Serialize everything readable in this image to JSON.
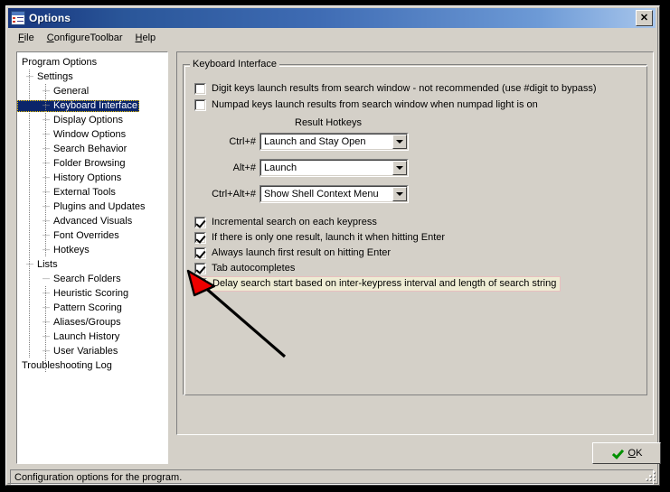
{
  "window": {
    "title": "Options",
    "icon": "options-checklist-icon",
    "close_label": "✕"
  },
  "menubar": {
    "items": [
      {
        "label": "File",
        "accel": "F"
      },
      {
        "label": "ConfigureToolbar",
        "accel": "C"
      },
      {
        "label": "Help",
        "accel": "H"
      }
    ]
  },
  "tree": {
    "items": [
      {
        "label": "Program Options",
        "level": 0,
        "selected": false
      },
      {
        "label": "Settings",
        "level": 1,
        "selected": false
      },
      {
        "label": "General",
        "level": 2,
        "selected": false
      },
      {
        "label": "Keyboard Interface",
        "level": 2,
        "selected": true
      },
      {
        "label": "Display Options",
        "level": 2,
        "selected": false
      },
      {
        "label": "Window Options",
        "level": 2,
        "selected": false
      },
      {
        "label": "Search Behavior",
        "level": 2,
        "selected": false
      },
      {
        "label": "Folder Browsing",
        "level": 2,
        "selected": false
      },
      {
        "label": "History Options",
        "level": 2,
        "selected": false
      },
      {
        "label": "External Tools",
        "level": 2,
        "selected": false
      },
      {
        "label": "Plugins and Updates",
        "level": 2,
        "selected": false
      },
      {
        "label": "Advanced Visuals",
        "level": 2,
        "selected": false
      },
      {
        "label": "Font Overrides",
        "level": 2,
        "selected": false
      },
      {
        "label": "Hotkeys",
        "level": 2,
        "selected": false
      },
      {
        "label": "Lists",
        "level": 1,
        "selected": false
      },
      {
        "label": "Search Folders",
        "level": 2,
        "selected": false
      },
      {
        "label": "Heuristic Scoring",
        "level": 2,
        "selected": false
      },
      {
        "label": "Pattern Scoring",
        "level": 2,
        "selected": false
      },
      {
        "label": "Aliases/Groups",
        "level": 2,
        "selected": false
      },
      {
        "label": "Launch History",
        "level": 2,
        "selected": false
      },
      {
        "label": "User Variables",
        "level": 2,
        "selected": false
      },
      {
        "label": "Troubleshooting Log",
        "level": 0,
        "selected": false
      }
    ]
  },
  "groupbox": {
    "title": "Keyboard Interface",
    "top_checkboxes": [
      {
        "label": "Digit keys launch results from search window  - not recommended (use #digit to bypass)",
        "checked": false
      },
      {
        "label": "Numpad keys launch results from search window when numpad light is on",
        "checked": false
      }
    ],
    "hotkeys_title": "Result Hotkeys",
    "hotkeys": [
      {
        "label": "Ctrl+#",
        "value": "Launch and Stay Open"
      },
      {
        "label": "Alt+#",
        "value": "Launch"
      },
      {
        "label": "Ctrl+Alt+#",
        "value": "Show Shell Context Menu"
      }
    ],
    "bottom_checkboxes": [
      {
        "label": "Incremental search on each keypress",
        "checked": true,
        "highlighted": false
      },
      {
        "label": "If there is only one result, launch it when hitting Enter",
        "checked": true,
        "highlighted": false
      },
      {
        "label": "Always launch first result on hitting Enter",
        "checked": true,
        "highlighted": false
      },
      {
        "label": "Tab autocompletes",
        "checked": true,
        "highlighted": false
      },
      {
        "label": "Delay search start based on inter-keypress interval and length of search string",
        "checked": true,
        "highlighted": true
      }
    ]
  },
  "ok_button": {
    "label": "OK",
    "accel": "O",
    "icon": "green-check-icon"
  },
  "statusbar": {
    "text": "Configuration options for the program."
  },
  "annotation": {
    "type": "arrow",
    "color": "#ee0000",
    "points_to": "Delay search start based on inter-keypress interval and length of search string"
  },
  "colors": {
    "face": "#d4d0c8",
    "selection": "#0a246a",
    "highlight_bg": "#eeecd4",
    "highlight_border": "#e8bfbf",
    "title_left": "#16347c",
    "title_right": "#a8c6ec"
  }
}
